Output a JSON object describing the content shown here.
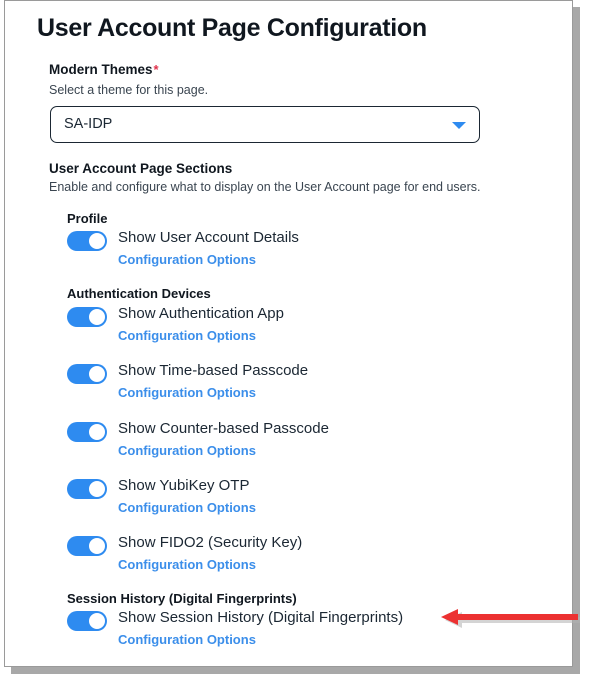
{
  "page": {
    "title": "User Account Page Configuration"
  },
  "theme_field": {
    "label": "Modern Themes",
    "required_marker": "*",
    "help": "Select a theme for this page.",
    "selected_value": "SA-IDP",
    "chevron_icon": "chevron-down-icon",
    "accent_color": "#2e8bf0",
    "required_color": "#e0314b"
  },
  "sections_block": {
    "title": "User Account Page Sections",
    "help": "Enable and configure what to display on the User Account page for end users."
  },
  "common": {
    "configuration_options_label": "Configuration Options",
    "link_color": "#3b8eea",
    "toggle_on_color": "#2e8bf0",
    "toggle_state": "on"
  },
  "groups": [
    {
      "name": "Profile",
      "rows": [
        {
          "label": "Show User Account Details",
          "link": "Configuration Options",
          "toggle": "on"
        }
      ]
    },
    {
      "name": "Authentication Devices",
      "rows": [
        {
          "label": "Show Authentication App",
          "link": "Configuration Options",
          "toggle": "on"
        },
        {
          "label": "Show Time-based Passcode",
          "link": "Configuration Options",
          "toggle": "on"
        },
        {
          "label": "Show Counter-based Passcode",
          "link": "Configuration Options",
          "toggle": "on"
        },
        {
          "label": "Show YubiKey OTP",
          "link": "Configuration Options",
          "toggle": "on"
        },
        {
          "label": "Show FIDO2 (Security Key)",
          "link": "Configuration Options",
          "toggle": "on"
        }
      ]
    },
    {
      "name": "Session History (Digital Fingerprints)",
      "rows": [
        {
          "label": "Show Session History (Digital Fingerprints)",
          "link": "Configuration Options",
          "toggle": "on"
        }
      ]
    }
  ],
  "annotation": {
    "type": "arrow-left",
    "color": "#ec3131",
    "points_at": "Show Session History (Digital Fingerprints)"
  }
}
